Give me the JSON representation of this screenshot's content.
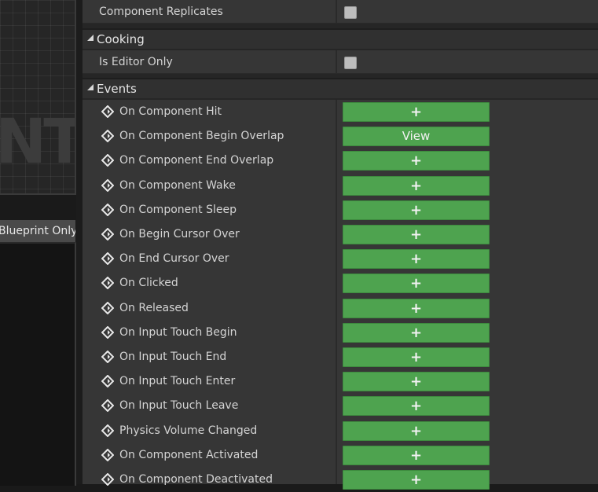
{
  "left_panel": {
    "graph_watermark": "NT",
    "tab_label": "Blueprint Only"
  },
  "details": {
    "top_row": {
      "label": "Component Replicates",
      "checked": false
    },
    "cooking": {
      "title": "Cooking",
      "rows": [
        {
          "label": "Is Editor Only",
          "checked": false
        }
      ]
    },
    "events": {
      "title": "Events",
      "items": [
        {
          "label": "On Component Hit",
          "button": "+"
        },
        {
          "label": "On Component Begin Overlap",
          "button": "View"
        },
        {
          "label": "On Component End Overlap",
          "button": "+"
        },
        {
          "label": "On Component Wake",
          "button": "+"
        },
        {
          "label": "On Component Sleep",
          "button": "+"
        },
        {
          "label": "On Begin Cursor Over",
          "button": "+"
        },
        {
          "label": "On End Cursor Over",
          "button": "+"
        },
        {
          "label": "On Clicked",
          "button": "+"
        },
        {
          "label": "On Released",
          "button": "+"
        },
        {
          "label": "On Input Touch Begin",
          "button": "+"
        },
        {
          "label": "On Input Touch End",
          "button": "+"
        },
        {
          "label": "On Input Touch Enter",
          "button": "+"
        },
        {
          "label": "On Input Touch Leave",
          "button": "+"
        },
        {
          "label": "Physics Volume Changed",
          "button": "+"
        },
        {
          "label": "On Component Activated",
          "button": "+"
        },
        {
          "label": "On Component Deactivated",
          "button": "+"
        }
      ]
    }
  },
  "colors": {
    "event_button": "#4ea34f",
    "panel_row": "#363636",
    "section_header": "#303030"
  },
  "icons": {
    "event": "event-diamond-icon",
    "collapse": "collapse-arrow-icon",
    "add": "plus-icon"
  }
}
